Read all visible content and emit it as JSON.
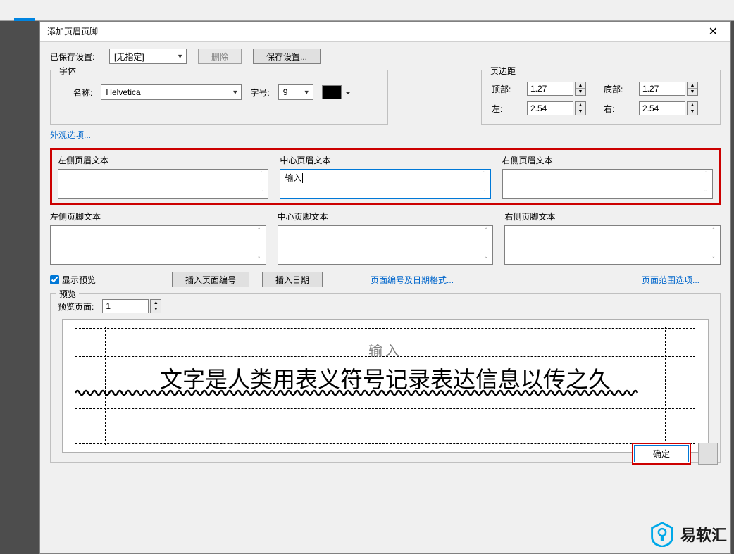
{
  "dialog": {
    "title": "添加页眉页脚",
    "saved_label": "已保存设置:",
    "saved_value": "[无指定]",
    "delete_btn": "删除",
    "save_settings_btn": "保存设置...",
    "font_legend": "字体",
    "name_label": "名称:",
    "font_name": "Helvetica",
    "size_label": "字号:",
    "font_size": "9",
    "appearance_link": "外观选项...",
    "margin_legend": "页边距",
    "margin_top_label": "顶部:",
    "margin_top": "1.27",
    "margin_bottom_label": "底部:",
    "margin_bottom": "1.27",
    "margin_left_label": "左:",
    "margin_left": "2.54",
    "margin_right_label": "右:",
    "margin_right": "2.54",
    "header_left_label": "左侧页眉文本",
    "header_center_label": "中心页眉文本",
    "header_center_value": "输入",
    "header_right_label": "右侧页眉文本",
    "footer_left_label": "左侧页脚文本",
    "footer_center_label": "中心页脚文本",
    "footer_right_label": "右侧页脚文本",
    "show_preview": "显示预览",
    "insert_page_num": "插入页面编号",
    "insert_date": "插入日期",
    "page_format_link": "页面编号及日期格式...",
    "page_range_link": "页面范围选项...",
    "preview_legend": "预览",
    "preview_page_label": "预览页面:",
    "preview_page_value": "1",
    "preview_header": "输入",
    "preview_body": "文字是人类用表义符号记录表达信息以传之久",
    "ok_btn": "确定"
  },
  "brand": "易软汇"
}
